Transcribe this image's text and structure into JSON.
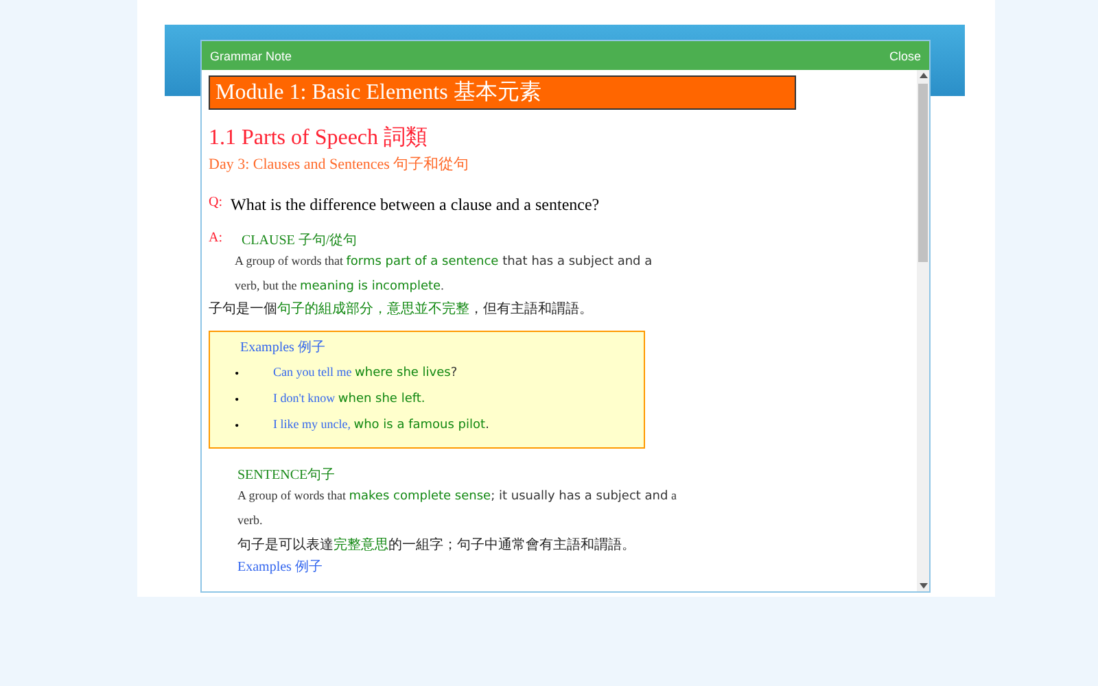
{
  "dialog": {
    "title": "Grammar Note",
    "close": "Close"
  },
  "module_title": "Module 1: Basic Elements 基本元素",
  "section_title": "1.1 Parts of Speech 詞類",
  "day_title": "Day 3: Clauses and Sentences 句子和從句",
  "question": {
    "marker": "Q:",
    "text": "What is the difference between a clause and a sentence?"
  },
  "answer": {
    "marker": "A:",
    "heading": "CLAUSE 子句/從句",
    "definition": [
      {
        "text": "A group of words that ",
        "kind": "serif"
      },
      {
        "text": "forms part of a sentence",
        "kind": "key"
      },
      {
        "text": " that has a subject and a",
        "kind": "comic"
      },
      {
        "text": " verb, but the ",
        "kind": "serif"
      },
      {
        "text": "meaning is incomplete",
        "kind": "key"
      },
      {
        "text": ".",
        "kind": "serif"
      }
    ],
    "chinese": [
      {
        "text": "子句是一個",
        "kind": "plain"
      },
      {
        "text": "句子的組成部分，意思並不完整",
        "kind": "key"
      },
      {
        "text": "，但有主語和謂語。",
        "kind": "plain"
      }
    ],
    "examples": {
      "title": "Examples 例子",
      "items": [
        {
          "bullet": "•",
          "segments": [
            {
              "text": "Can you tell me ",
              "kind": "blue"
            },
            {
              "text": "where she lives",
              "kind": "key"
            },
            {
              "text": "?",
              "kind": "comic"
            }
          ]
        },
        {
          "bullet": "•",
          "segments": [
            {
              "text": "I don't know ",
              "kind": "blue"
            },
            {
              "text": "when she left.",
              "kind": "key"
            }
          ]
        },
        {
          "bullet": "•",
          "segments": [
            {
              "text": "I like my uncle, ",
              "kind": "blue"
            },
            {
              "text": "who is a famous pilot",
              "kind": "key"
            },
            {
              "text": ".",
              "kind": "comic"
            }
          ]
        }
      ]
    }
  },
  "sentence": {
    "heading": "SENTENCE句子",
    "definition": [
      {
        "text": "A group of words that ",
        "kind": "serif"
      },
      {
        "text": "makes complete sense",
        "kind": "key"
      },
      {
        "text": "; it usually has a subject and",
        "kind": "comic"
      },
      {
        "text": " a verb.",
        "kind": "serif"
      }
    ],
    "chinese": [
      {
        "text": "句子是可以表達",
        "kind": "plain"
      },
      {
        "text": "完整意思",
        "kind": "key"
      },
      {
        "text": "的一組字；句子中通常會有主語和謂語。",
        "kind": "plain"
      }
    ],
    "examples_title": "Examples 例子"
  }
}
